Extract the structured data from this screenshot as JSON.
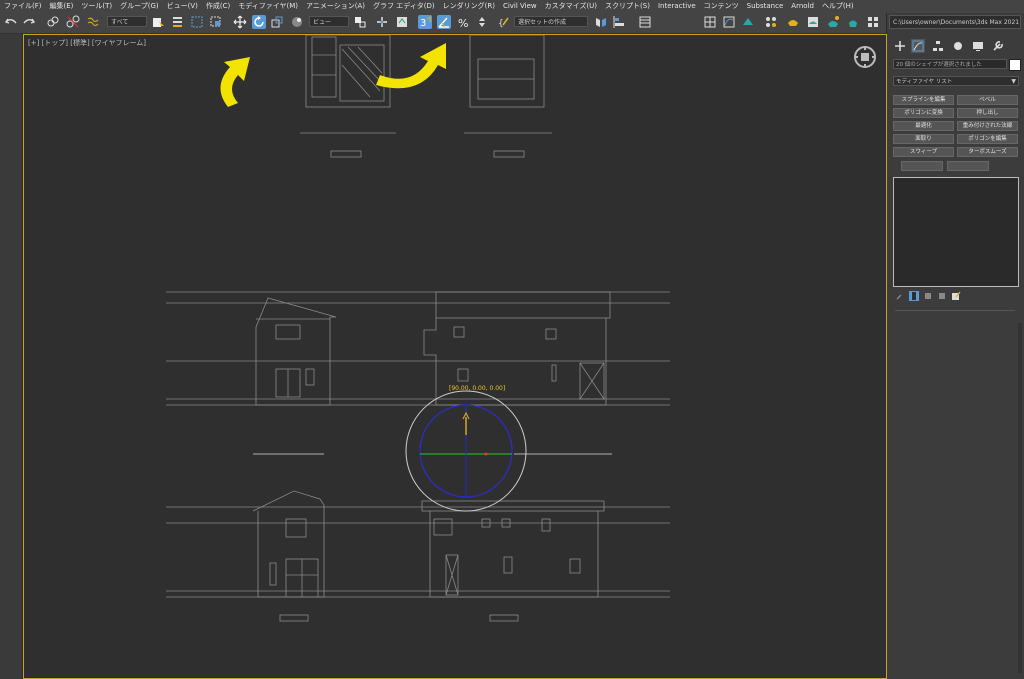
{
  "menu": [
    "ファイル(F)",
    "編集(E)",
    "ツール(T)",
    "グループ(G)",
    "ビュー(V)",
    "作成(C)",
    "モディファイヤ(M)",
    "アニメーション(A)",
    "グラフ エディタ(D)",
    "レンダリング(R)",
    "Civil View",
    "カスタマイズ(U)",
    "スクリプト(S)",
    "Interactive",
    "コンテンツ",
    "Substance",
    "Arnold",
    "ヘルプ(H)"
  ],
  "toolbar": {
    "selection_filter": "すべて",
    "ref_coord": "ビュー",
    "named_selection": "選択セットの作成"
  },
  "viewport": {
    "label": "[+] [トップ] [標準] [ワイヤフレーム]",
    "rotate_readout": "[90.00, 0.00, 0.00]"
  },
  "command_panel": {
    "path": "C:\\Users\\owner\\Documents\\3ds Max 2021",
    "name_field": "20 個のシェイプが選択されました",
    "modifier_list": "モディファイヤ リスト",
    "buttons": [
      "スプラインを編集",
      "ベベル",
      "ポリゴンに変換",
      "押し出し",
      "最適化",
      "重み付けされた法線",
      "面取り",
      "ポリゴンを編集",
      "スウィープ",
      "ターボスムーズ"
    ]
  },
  "colors": {
    "accent": "#5b9bd5",
    "arrow": "#f2e400",
    "viewport_border": "#caa22a",
    "gizmo_x": "#2fa82f",
    "gizmo_y": "#2a2acc",
    "gizmo_z": "#e0b020"
  },
  "icons": [
    "undo-icon",
    "redo-icon",
    "link-icon",
    "unlink-icon",
    "bind-spacewarp-icon",
    "select-icon",
    "select-by-name-icon",
    "rect-region-icon",
    "window-crossing-icon",
    "move-icon",
    "rotate-icon",
    "scale-icon",
    "place-icon",
    "pivot-icon",
    "manipulate-icon",
    "snap-3d-icon",
    "angle-snap-icon",
    "percent-snap-icon",
    "spinner-snap-icon",
    "edit-named-selection-icon",
    "mirror-icon",
    "align-icon",
    "layer-icon",
    "scene-explorer-icon",
    "curve-editor-icon",
    "schematic-icon",
    "material-editor-icon",
    "render-setup-icon",
    "render-frame-icon",
    "render-icon",
    "teapot-icon",
    "viewport-layout-icon"
  ]
}
